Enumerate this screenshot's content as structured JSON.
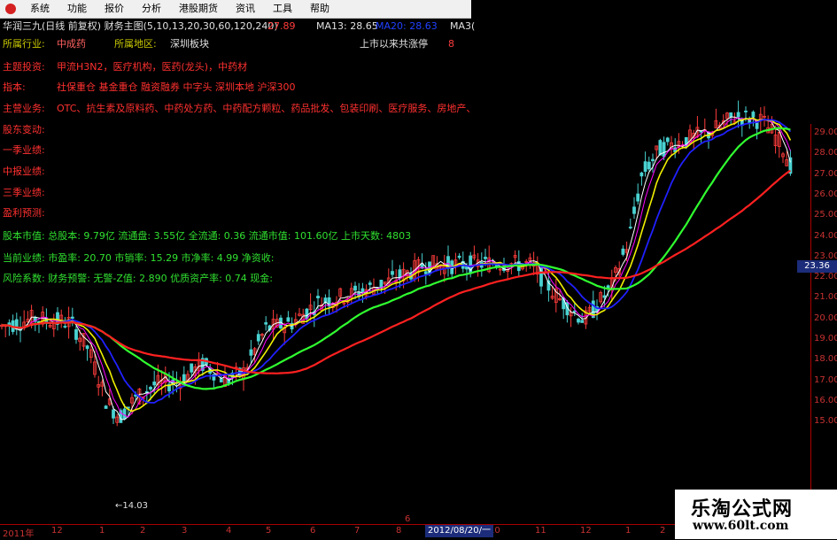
{
  "menu": [
    "系统",
    "功能",
    "报价",
    "分析",
    "港股期货",
    "资讯",
    "工具",
    "帮助"
  ],
  "header": {
    "stock": "华润三九(日线 前复权) 财务主图(5,10,13,20,30,60,120,240)",
    "value1": "27.89",
    "ma13": "MA13: 28.65",
    "ma20": "MA20: 28.63",
    "ma30": "MA3("
  },
  "info": {
    "industry_label": "所属行业:",
    "industry_value": "中成药",
    "region_label": "所属地区:",
    "region_value": "深圳板块",
    "limit_label": "上市以来共涨停",
    "limit_value": "8",
    "theme_label": "主题投资:",
    "theme_value": "甲流H3N2，医疗机构，医药(龙头)，中药材",
    "index_label": "指本:",
    "index_value": "社保重仓 基金重仓 融资融券 中字头 深圳本地 沪深300",
    "business_label": "主营业务:",
    "business_value": "OTC、抗生素及原料药、中药处方药、中药配方颗粒、药品批发、包装印刷、医疗服务、房地产、医药行业...",
    "shareholder_label": "股东变动:",
    "q1_label": "一季业绩:",
    "mid_label": "中报业绩:",
    "q3_label": "三季业绩:",
    "forecast_label": "盈利预测:",
    "equity": "股本市值: 总股本: 9.79亿 流通盘: 3.55亿 全流通: 0.36 流通市值: 101.60亿 上市天数: 4803",
    "current": "当前业绩: 市盈率: 20.70 市销率: 15.29 市净率: 4.99 净资收:",
    "risk": "风险系数: 财务预警: 无警-Z值: 2.890 优质资产率: 0.74 现金:"
  },
  "yaxis": {
    "ticks": [
      "29.00",
      "28.00",
      "27.00",
      "26.00",
      "25.00",
      "24.00",
      "23.00",
      "22.00",
      "21.00",
      "20.00",
      "19.00",
      "18.00",
      "17.00",
      "16.00",
      "15.00"
    ],
    "current_price": "23.36"
  },
  "low_marker": "←14.03",
  "xaxis": {
    "ticks": [
      "2011年",
      "12",
      "1",
      "2",
      "3",
      "4",
      "5",
      "6",
      "7",
      "8",
      "9",
      "10",
      "11",
      "12",
      "1",
      "2"
    ],
    "cursor_date": "2012/08/20/一",
    "mark": "6"
  },
  "watermark": {
    "title": "乐淘公式网",
    "url": "www.60lt.com"
  },
  "colors": {
    "up": "#ff3c3c",
    "down": "#4ad2d2",
    "ma5": "#ffffff",
    "ma10": "#f0f000",
    "ma20": "#ff00ff",
    "ma30": "#00d000",
    "ma60": "#2020ff",
    "ma120": "#30ff30",
    "ma240": "#ff2020"
  }
}
